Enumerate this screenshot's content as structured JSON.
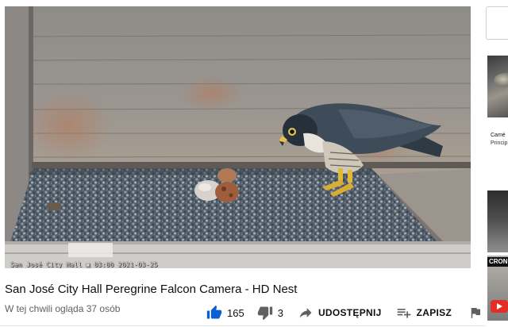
{
  "video": {
    "timestamp_overlay": "San José City Hall  ▣ 03:00 2021-03-25",
    "scene": "peregrine-falcon-adult-standing-over-eggs-in-gravel-nest-box"
  },
  "title": "San José City Hall Peregrine Falcon Camera - HD Nest",
  "viewers": "W tej chwili ogląda 37 osób",
  "actions": {
    "like_count": "165",
    "dislike_count": "3",
    "share_label": "UDOSTĘPNIJ",
    "save_label": "ZAPISZ",
    "like_icon": "thumbs-up-icon",
    "dislike_icon": "thumbs-down-icon",
    "share_icon": "share-arrow-icon",
    "save_icon": "playlist-add-icon",
    "flag_icon": "flag-icon",
    "like_color": "#065fd4",
    "icon_color": "#606060"
  },
  "sidebar": {
    "item1_line1": "Camé",
    "item1_line2": "Princip",
    "item3_badge": "CRON"
  }
}
